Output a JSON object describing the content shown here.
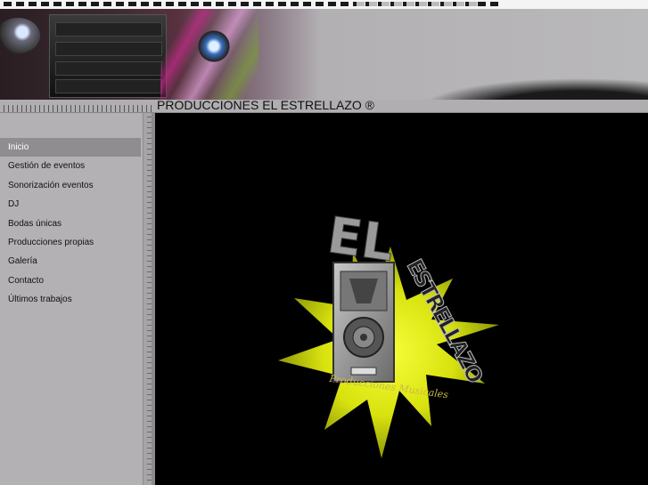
{
  "site": {
    "title": "PRODUCCIONES EL ESTRELLAZO ®"
  },
  "nav": {
    "items": [
      {
        "label": "Inicio",
        "active": true
      },
      {
        "label": "Gestión de eventos"
      },
      {
        "label": "Sonorización eventos"
      },
      {
        "label": "DJ"
      },
      {
        "label": "Bodas únicas"
      },
      {
        "label": "Producciones propias"
      },
      {
        "label": "Galería"
      },
      {
        "label": "Contacto"
      },
      {
        "label": "Últimos trabajos"
      }
    ]
  },
  "logo": {
    "word_el": "EL",
    "word_estrellazo": "ESTRELLAZO",
    "caption": "Producciones Musicales"
  },
  "colors": {
    "background": "#000000",
    "sidebar": "#b3b1b3",
    "active_item": "#8f8d8f",
    "star": "#e8ee1a"
  }
}
